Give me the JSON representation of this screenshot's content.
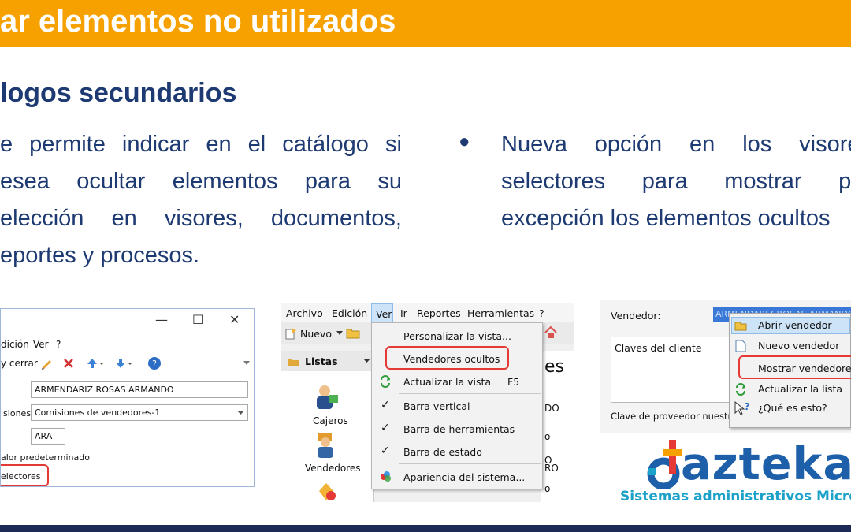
{
  "slide": {
    "title": "ar elementos no utilizados",
    "subtitle": "logos secundarios",
    "left_paragraph": [
      [
        "e",
        "permite",
        "indicar",
        "en",
        "el",
        "catálogo",
        "si"
      ],
      [
        "esea",
        "ocultar",
        "elementos",
        "para",
        "su"
      ],
      [
        "elección",
        "en",
        "visores,",
        "documentos,"
      ],
      [
        "eportes y procesos."
      ]
    ],
    "bullet": "●",
    "right_paragraph": [
      [
        "Nueva",
        "opción",
        "en",
        "los",
        "visores"
      ],
      [
        "selectores",
        "para",
        "mostrar",
        "por"
      ],
      [
        "excepción los elementos ocultos"
      ]
    ]
  },
  "screenshot1": {
    "window_controls": [
      "—",
      "☐",
      "✕"
    ],
    "menu": [
      "dición",
      "Ver",
      "?"
    ],
    "toolbar": {
      "save_close": "y cerrar"
    },
    "fields": {
      "name_value": "ARMENDARIZ ROSAS ARMANDO",
      "commission_label": "isiones:",
      "commission_value": "Comisiones de vendedores-1",
      "code_value": "ARA"
    },
    "labels": {
      "default_value": "alor predeterminado",
      "selectors": "electores"
    }
  },
  "screenshot2": {
    "menubar": [
      "Archivo",
      "Edición",
      "Ver",
      "Ir",
      "Reportes",
      "Herramientas",
      "?"
    ],
    "toolbar_new": "Nuevo",
    "sidebar": {
      "header": "Listas",
      "items": [
        "Cajeros",
        "Vendedores"
      ]
    },
    "dropdown": [
      {
        "label": "Personalizar la vista...",
        "shortcut": "",
        "checked": false
      },
      {
        "label": "Vendedores ocultos",
        "shortcut": "",
        "checked": false,
        "highlighted": true
      },
      {
        "label": "Actualizar la vista",
        "shortcut": "F5",
        "checked": false
      },
      {
        "label": "Barra vertical",
        "shortcut": "",
        "checked": true
      },
      {
        "label": "Barra de herramientas",
        "shortcut": "",
        "checked": true
      },
      {
        "label": "Barra de estado",
        "shortcut": "",
        "checked": true
      },
      {
        "label": "Apariencia del sistema...",
        "shortcut": "",
        "checked": false
      }
    ],
    "right_fragments": [
      "es",
      "DO",
      "o",
      "O",
      "RO",
      "o"
    ]
  },
  "screenshot3": {
    "vendor_label": "Vendedor:",
    "vendor_value": "ARMENDARIZ ROSAS ARMANDO",
    "box_label": "Claves del cliente",
    "supplier_label": "Clave de proveedor nuestra",
    "context_menu": [
      {
        "label": "Abrir vendedor",
        "icon": "folder-open-icon"
      },
      {
        "label": "Nuevo vendedor",
        "icon": "new-document-icon"
      },
      {
        "label": "Mostrar vendedores",
        "icon": "",
        "highlighted": true
      },
      {
        "label": "Actualizar la lista",
        "icon": "refresh-icon"
      },
      {
        "label": "¿Qué es esto?",
        "icon": "help-cursor-icon"
      }
    ]
  },
  "logo": {
    "word": "dazteka",
    "tagline": "Sistemas administrativos Microsip"
  },
  "colors": {
    "title_bar": "#f7a100",
    "text_blue": "#1e3a72",
    "highlight_red": "#e53935",
    "logo_blue": "#1d5fa8",
    "logo_cyan": "#1ca1c9"
  }
}
